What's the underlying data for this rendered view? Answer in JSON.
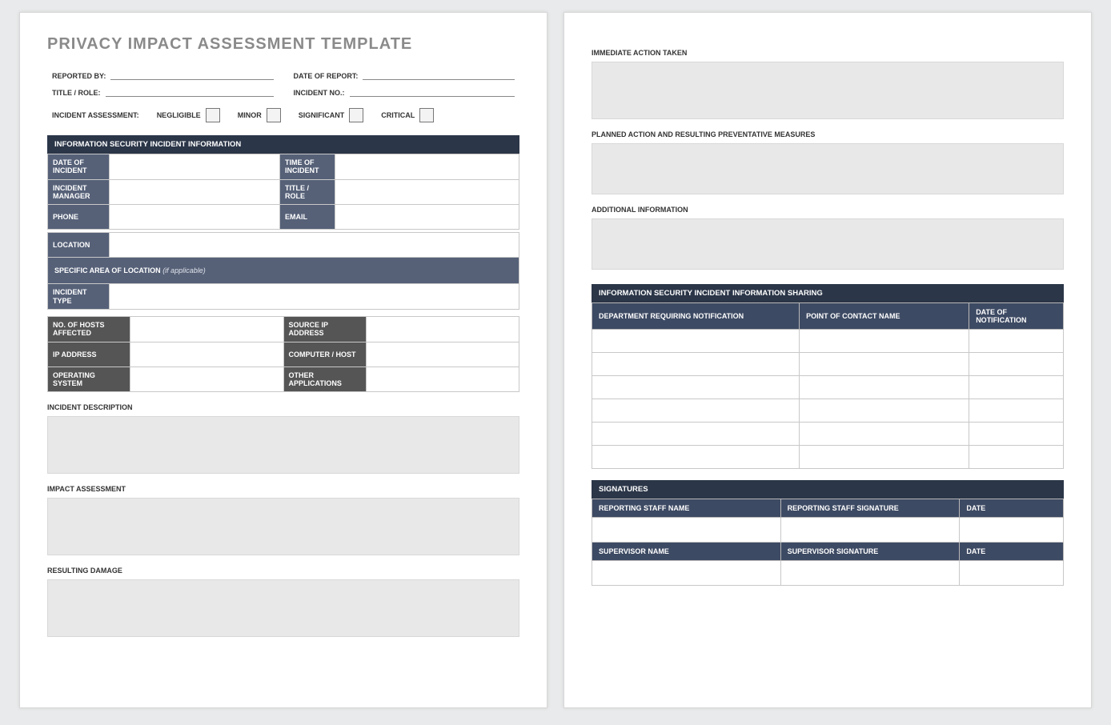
{
  "title": "PRIVACY IMPACT ASSESSMENT TEMPLATE",
  "header": {
    "reported_by": "REPORTED BY:",
    "date_of_report": "DATE OF REPORT:",
    "title_role": "TITLE / ROLE:",
    "incident_no": "INCIDENT NO.:",
    "assessment_label": "INCIDENT ASSESSMENT:",
    "levels": {
      "negligible": "NEGLIGIBLE",
      "minor": "MINOR",
      "significant": "SIGNIFICANT",
      "critical": "CRITICAL"
    }
  },
  "section_info": "INFORMATION SECURITY INCIDENT INFORMATION",
  "info": {
    "date_of_incident": "DATE OF INCIDENT",
    "time_of_incident": "TIME OF INCIDENT",
    "incident_manager": "INCIDENT MANAGER",
    "title_role": "TITLE / ROLE",
    "phone": "PHONE",
    "email": "EMAIL",
    "location": "LOCATION",
    "specific_area": "SPECIFIC AREA OF LOCATION",
    "specific_area_note": "(if applicable)",
    "incident_type": "INCIDENT TYPE"
  },
  "tech": {
    "hosts_affected": "NO. OF HOSTS AFFECTED",
    "source_ip": "SOURCE IP ADDRESS",
    "ip_address": "IP ADDRESS",
    "computer_host": "COMPUTER / HOST",
    "os": "OPERATING SYSTEM",
    "other_apps": "OTHER APPLICATIONS"
  },
  "sections": {
    "incident_description": "INCIDENT DESCRIPTION",
    "impact_assessment": "IMPACT ASSESSMENT",
    "resulting_damage": "RESULTING DAMAGE",
    "immediate_action": "IMMEDIATE ACTION TAKEN",
    "planned_action": "PLANNED ACTION AND RESULTING PREVENTATIVE MEASURES",
    "additional_info": "ADDITIONAL INFORMATION"
  },
  "sharing": {
    "title": "INFORMATION SECURITY INCIDENT INFORMATION SHARING",
    "col1": "DEPARTMENT REQUIRING NOTIFICATION",
    "col2": "POINT OF CONTACT NAME",
    "col3": "DATE OF NOTIFICATION"
  },
  "signatures": {
    "title": "SIGNATURES",
    "reporting_name": "REPORTING STAFF NAME",
    "reporting_sig": "REPORTING STAFF SIGNATURE",
    "date": "DATE",
    "supervisor_name": "SUPERVISOR NAME",
    "supervisor_sig": "SUPERVISOR SIGNATURE"
  }
}
